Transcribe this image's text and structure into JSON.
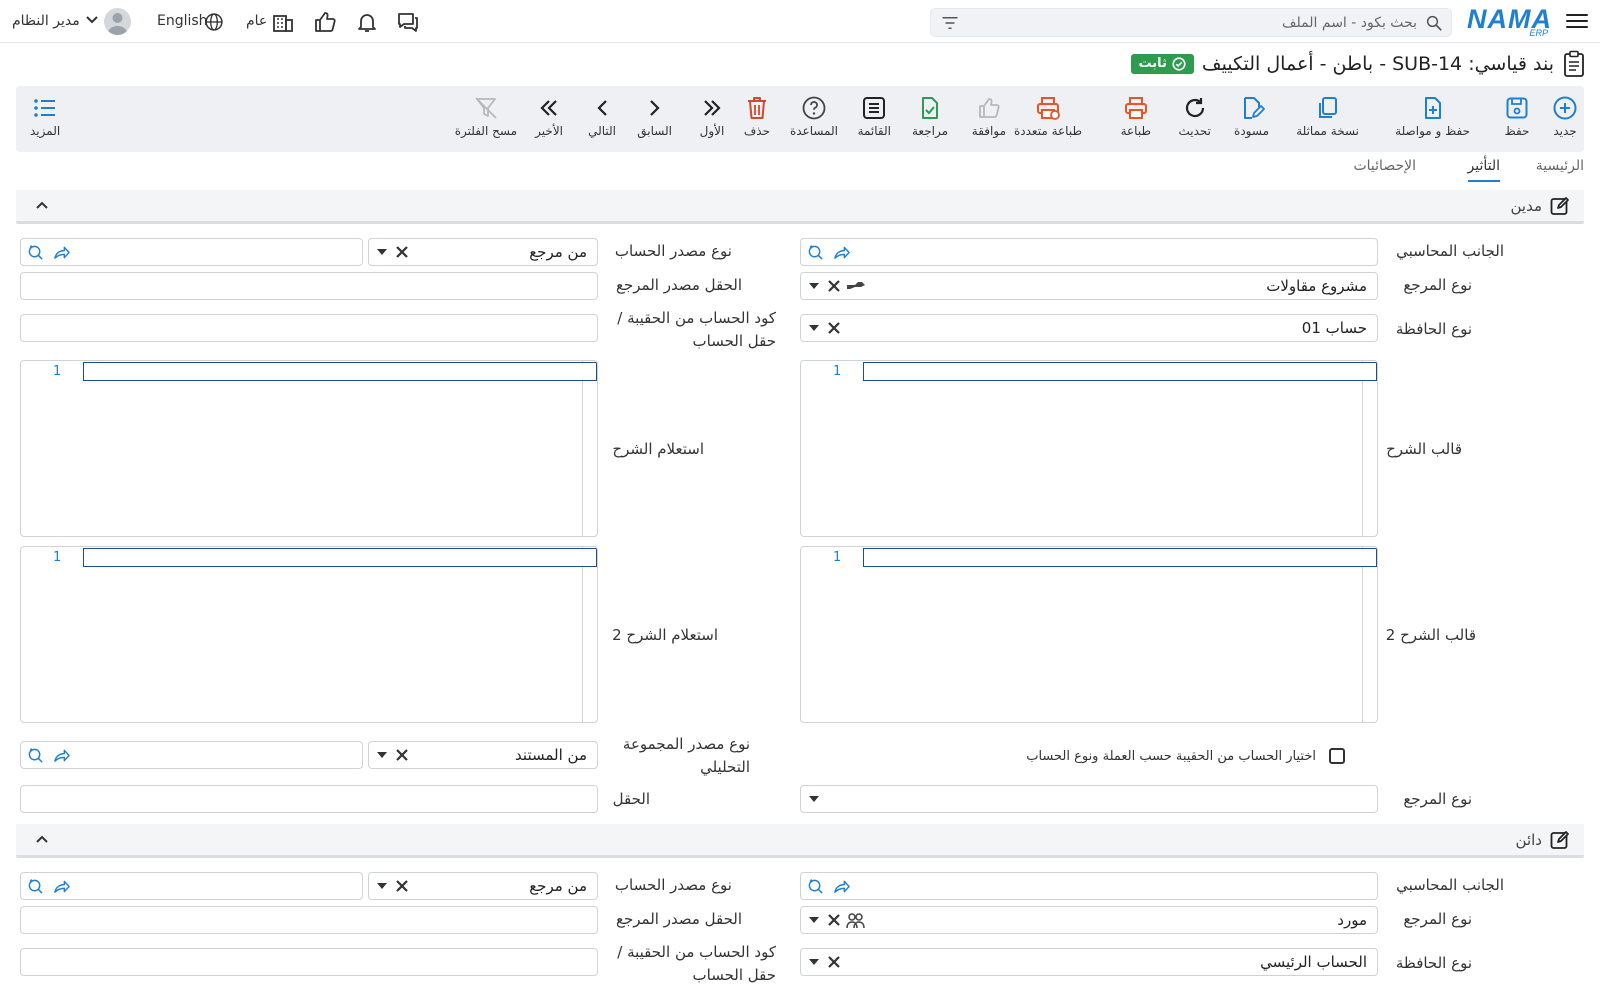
{
  "header": {
    "logo_text": "NAMA",
    "logo_sub": "ERP",
    "search_placeholder": "بحث بكود - اسم الملف",
    "branch_label": "عام",
    "language_label": "English",
    "user_name": "مدير النظام"
  },
  "page": {
    "title": "بند قياسي: SUB-14 - باطن - أعمال التكييف",
    "status_badge": "ثابت"
  },
  "toolbar": {
    "items": [
      {
        "id": "new",
        "label": "جديد"
      },
      {
        "id": "save",
        "label": "حفظ"
      },
      {
        "id": "save_continue",
        "label": "حفظ و مواصلة"
      },
      {
        "id": "duplicate",
        "label": "نسخة مماثلة"
      },
      {
        "id": "draft",
        "label": "مسودة"
      },
      {
        "id": "refresh",
        "label": "تحديث"
      },
      {
        "id": "print",
        "label": "طباعة"
      },
      {
        "id": "multi_print",
        "label": "طباعة متعددة"
      },
      {
        "id": "approve",
        "label": "موافقة"
      },
      {
        "id": "review",
        "label": "مراجعة"
      },
      {
        "id": "list",
        "label": "القائمة"
      },
      {
        "id": "help",
        "label": "المساعدة"
      },
      {
        "id": "delete",
        "label": "حذف"
      },
      {
        "id": "first",
        "label": "الأول"
      },
      {
        "id": "previous",
        "label": "السابق"
      },
      {
        "id": "next",
        "label": "التالي"
      },
      {
        "id": "last",
        "label": "الأخير"
      },
      {
        "id": "clear_filter",
        "label": "مسح الفلترة"
      }
    ],
    "more_label": "المزيد"
  },
  "tabs": [
    {
      "label": "الرئيسية",
      "active": false
    },
    {
      "label": "التأثير",
      "active": true
    },
    {
      "label": "الإحصائيات",
      "active": false
    }
  ],
  "debit": {
    "title": "مدين",
    "accounting_side_label": "الجانب المحاسبي",
    "account_source_type_label": "نوع مصدر الحساب",
    "account_source_type_value": "من مرجع",
    "ref_type_label": "نوع المرجع",
    "ref_type_value": "مشروع مقاولات",
    "ref_source_field_label": "الحقل مصدر المرجع",
    "wallet_type_label": "نوع الحافظة",
    "wallet_type_value": "حساب 01",
    "account_code_label": "كود الحساب من الحقيبة / حقل الحساب",
    "desc_template_label": "قالب الشرح",
    "desc_query_label": "استعلام الشرح",
    "desc_template2_label": "قالب الشرح 2",
    "desc_query2_label": "استعلام الشرح 2",
    "line_number": "1",
    "analytic_source_label": "نوع مصدر المجموعة التحليلي",
    "analytic_source_value": "من المستند",
    "bag_checkbox_label": "اختيار الحساب من الحقيبة حسب العملة ونوع الحساب",
    "bag_checkbox_checked": false,
    "ref_type2_label": "نوع المرجع",
    "field_label": "الحقل"
  },
  "credit": {
    "title": "دائن",
    "accounting_side_label": "الجانب المحاسبي",
    "account_source_type_label": "نوع مصدر الحساب",
    "account_source_type_value": "من مرجع",
    "ref_type_label": "نوع المرجع",
    "ref_type_value": "مورد",
    "ref_source_field_label": "الحقل مصدر المرجع",
    "wallet_type_label": "نوع الحافظة",
    "wallet_type_value": "الحساب الرئيسي",
    "account_code_label": "كود الحساب من الحقيبة / حقل الحساب"
  },
  "colors": {
    "brand": "#1f7fd1",
    "badge_green": "#2e9b4f",
    "icon_blue": "#1f7fd1",
    "icon_green": "#2e9b4f",
    "icon_orange": "#e8542a",
    "icon_red": "#d04a2a"
  }
}
